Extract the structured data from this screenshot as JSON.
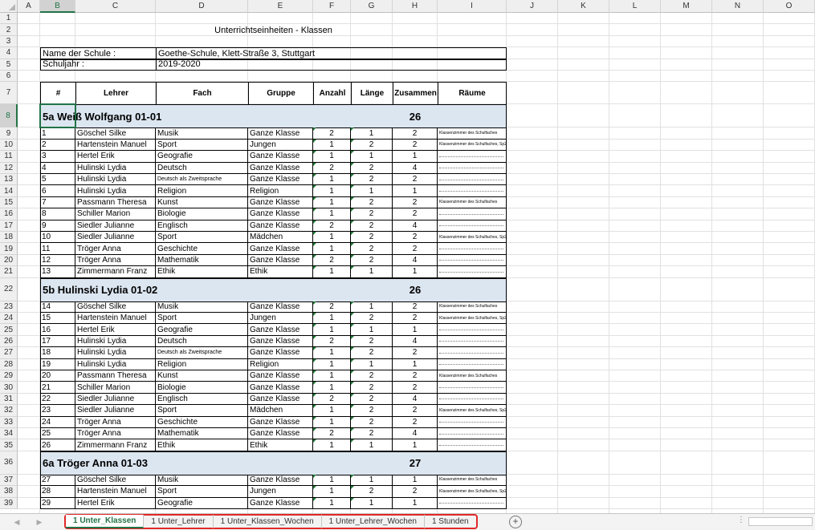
{
  "columns": [
    "A",
    "B",
    "C",
    "D",
    "E",
    "F",
    "G",
    "H",
    "I",
    "J",
    "K",
    "L",
    "M",
    "N",
    "O"
  ],
  "selected_column": "B",
  "selected_row": "8",
  "title": "Unterrichtseinheiten - Klassen",
  "school_label": "Name der Schule :",
  "school_value": "Goethe-Schule, Klett-Straße 3, Stuttgart",
  "year_label": "Schuljahr :",
  "year_value": "2019-2020",
  "headers": [
    "#",
    "Lehrer",
    "Fach",
    "Gruppe",
    "Anzahl",
    "Länge",
    "Zusammen",
    "Räume"
  ],
  "rows": [
    {
      "r": "1",
      "t": "empty"
    },
    {
      "r": "2",
      "t": "title"
    },
    {
      "r": "3",
      "t": "empty"
    },
    {
      "r": "4",
      "t": "school"
    },
    {
      "r": "5",
      "t": "year"
    },
    {
      "r": "6",
      "t": "empty"
    },
    {
      "r": "7",
      "t": "header"
    },
    {
      "r": "8",
      "t": "group",
      "title": "5a Weiß Wolfgang 01-01",
      "total": "26"
    },
    {
      "r": "9",
      "t": "data",
      "c": [
        "1",
        "Göschel Silke",
        "Musik",
        "Ganze Klasse",
        "2",
        "1",
        "2",
        "Klassenzimmer des Schulfaches"
      ],
      "room_size": "tiny"
    },
    {
      "r": "10",
      "t": "data",
      "c": [
        "2",
        "Hartenstein Manuel",
        "Sport",
        "Jungen",
        "1",
        "2",
        "2",
        "Klassenzimmer des Schulfaches, Sp2"
      ],
      "room_size": "tiny"
    },
    {
      "r": "11",
      "t": "data",
      "c": [
        "3",
        "Hertel Erik",
        "Geografie",
        "Ganze Klasse",
        "1",
        "1",
        "1",
        ""
      ]
    },
    {
      "r": "12",
      "t": "data",
      "c": [
        "4",
        "Hulinski Lydia",
        "Deutsch",
        "Ganze Klasse",
        "2",
        "2",
        "4",
        ""
      ]
    },
    {
      "r": "13",
      "t": "data",
      "c": [
        "5",
        "Hulinski Lydia",
        "Deutsch als Zweitsprache",
        "Ganze Klasse",
        "1",
        "2",
        "2",
        ""
      ],
      "fach_small": true
    },
    {
      "r": "14",
      "t": "data",
      "c": [
        "6",
        "Hulinski Lydia",
        "Religion",
        "Religion",
        "1",
        "1",
        "1",
        ""
      ]
    },
    {
      "r": "15",
      "t": "data",
      "c": [
        "7",
        "Passmann Theresa",
        "Kunst",
        "Ganze Klasse",
        "1",
        "2",
        "2",
        "Klassenzimmer des Schulfaches"
      ],
      "room_size": "tiny"
    },
    {
      "r": "16",
      "t": "data",
      "c": [
        "8",
        "Schiller Marion",
        "Biologie",
        "Ganze Klasse",
        "1",
        "2",
        "2",
        ""
      ]
    },
    {
      "r": "17",
      "t": "data",
      "c": [
        "9",
        "Siedler Julianne",
        "Englisch",
        "Ganze Klasse",
        "2",
        "2",
        "4",
        ""
      ]
    },
    {
      "r": "18",
      "t": "data",
      "c": [
        "10",
        "Siedler Julianne",
        "Sport",
        "Mädchen",
        "1",
        "2",
        "2",
        "Klassenzimmer des Schulfaches, Sp2"
      ],
      "room_size": "tiny"
    },
    {
      "r": "19",
      "t": "data",
      "c": [
        "11",
        "Tröger Anna",
        "Geschichte",
        "Ganze Klasse",
        "1",
        "2",
        "2",
        ""
      ]
    },
    {
      "r": "20",
      "t": "data",
      "c": [
        "12",
        "Tröger Anna",
        "Mathematik",
        "Ganze Klasse",
        "2",
        "2",
        "4",
        ""
      ]
    },
    {
      "r": "21",
      "t": "data",
      "c": [
        "13",
        "Zimmermann Franz",
        "Ethik",
        "Ethik",
        "1",
        "1",
        "1",
        ""
      ]
    },
    {
      "r": "22",
      "t": "group",
      "title": "5b Hulinski Lydia 01-02",
      "total": "26"
    },
    {
      "r": "23",
      "t": "data",
      "c": [
        "14",
        "Göschel Silke",
        "Musik",
        "Ganze Klasse",
        "2",
        "1",
        "2",
        "Klassenzimmer des Schulfaches"
      ],
      "room_size": "tiny"
    },
    {
      "r": "24",
      "t": "data",
      "c": [
        "15",
        "Hartenstein Manuel",
        "Sport",
        "Jungen",
        "1",
        "2",
        "2",
        "Klassenzimmer des Schulfaches, Sp2"
      ],
      "room_size": "tiny"
    },
    {
      "r": "25",
      "t": "data",
      "c": [
        "16",
        "Hertel Erik",
        "Geografie",
        "Ganze Klasse",
        "1",
        "1",
        "1",
        ""
      ]
    },
    {
      "r": "26",
      "t": "data",
      "c": [
        "17",
        "Hulinski Lydia",
        "Deutsch",
        "Ganze Klasse",
        "2",
        "2",
        "4",
        ""
      ]
    },
    {
      "r": "27",
      "t": "data",
      "c": [
        "18",
        "Hulinski Lydia",
        "Deutsch als Zweitsprache",
        "Ganze Klasse",
        "1",
        "2",
        "2",
        ""
      ],
      "fach_small": true
    },
    {
      "r": "28",
      "t": "data",
      "c": [
        "19",
        "Hulinski Lydia",
        "Religion",
        "Religion",
        "1",
        "1",
        "1",
        ""
      ]
    },
    {
      "r": "29",
      "t": "data",
      "c": [
        "20",
        "Passmann Theresa",
        "Kunst",
        "Ganze Klasse",
        "1",
        "2",
        "2",
        "Klassenzimmer des Schulfaches"
      ],
      "room_size": "tiny"
    },
    {
      "r": "30",
      "t": "data",
      "c": [
        "21",
        "Schiller Marion",
        "Biologie",
        "Ganze Klasse",
        "1",
        "2",
        "2",
        ""
      ]
    },
    {
      "r": "31",
      "t": "data",
      "c": [
        "22",
        "Siedler Julianne",
        "Englisch",
        "Ganze Klasse",
        "2",
        "2",
        "4",
        ""
      ]
    },
    {
      "r": "32",
      "t": "data",
      "c": [
        "23",
        "Siedler Julianne",
        "Sport",
        "Mädchen",
        "1",
        "2",
        "2",
        "Klassenzimmer des Schulfaches, Sp2"
      ],
      "room_size": "tiny"
    },
    {
      "r": "33",
      "t": "data",
      "c": [
        "24",
        "Tröger Anna",
        "Geschichte",
        "Ganze Klasse",
        "1",
        "2",
        "2",
        ""
      ]
    },
    {
      "r": "34",
      "t": "data",
      "c": [
        "25",
        "Tröger Anna",
        "Mathematik",
        "Ganze Klasse",
        "2",
        "2",
        "4",
        ""
      ]
    },
    {
      "r": "35",
      "t": "data",
      "c": [
        "26",
        "Zimmermann Franz",
        "Ethik",
        "Ethik",
        "1",
        "1",
        "1",
        ""
      ]
    },
    {
      "r": "36",
      "t": "group",
      "title": "6a Tröger Anna 01-03",
      "total": "27"
    },
    {
      "r": "37",
      "t": "data",
      "c": [
        "27",
        "Göschel Silke",
        "Musik",
        "Ganze Klasse",
        "1",
        "1",
        "1",
        "Klassenzimmer des Schulfaches"
      ],
      "room_size": "tiny"
    },
    {
      "r": "38",
      "t": "data",
      "c": [
        "28",
        "Hartenstein Manuel",
        "Sport",
        "Jungen",
        "1",
        "2",
        "2",
        "Klassenzimmer des Schulfaches, Sp2"
      ],
      "room_size": "tiny"
    },
    {
      "r": "39",
      "t": "data",
      "c": [
        "29",
        "Hertel Erik",
        "Geografie",
        "Ganze Klasse",
        "1",
        "1",
        "1",
        ""
      ]
    }
  ],
  "tabs": [
    "1 Unter_Klassen",
    "1 Unter_Lehrer",
    "1 Unter_Klassen_Wochen",
    "1 Unter_Lehrer_Wochen",
    "1 Stunden"
  ],
  "active_tab": 0,
  "add_sheet_label": "+",
  "scroll_dots": "⋮",
  "nav_prev": "◀",
  "nav_next": "▶",
  "colors": {
    "accent": "#217346",
    "group_fill": "#dce6f1",
    "tab_highlight": "#e02828",
    "marker": "#1e7b34"
  }
}
